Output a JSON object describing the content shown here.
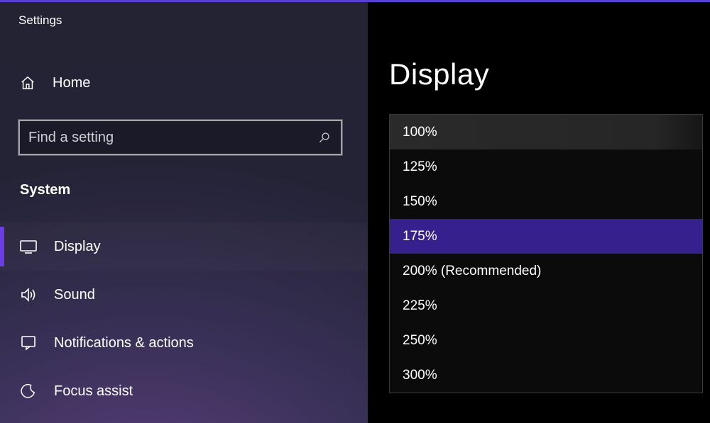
{
  "app_title": "Settings",
  "home_label": "Home",
  "search": {
    "placeholder": "Find a setting"
  },
  "section": "System",
  "nav": {
    "display": "Display",
    "sound": "Sound",
    "notifications": "Notifications & actions",
    "focus_assist": "Focus assist"
  },
  "page_title": "Display",
  "scale_options": {
    "opt0": "100%",
    "opt1": "125%",
    "opt2": "150%",
    "opt3": "175%",
    "opt4": "200% (Recommended)",
    "opt5": "225%",
    "opt6": "250%",
    "opt7": "300%"
  },
  "selected_scale": "175%"
}
